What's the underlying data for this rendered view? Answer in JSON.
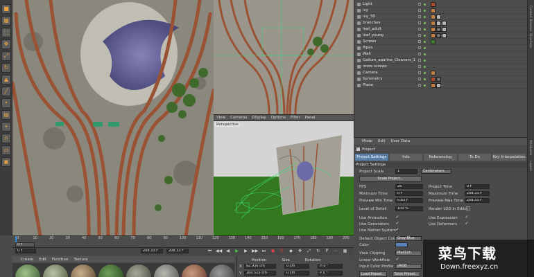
{
  "icons": {
    "toolbar": [
      "cube-icon",
      "checker-icon",
      "select-icon",
      "move-icon",
      "scale-icon",
      "rotate-icon",
      "polygon-icon",
      "edge-icon",
      "point-icon",
      "texture-icon",
      "snap-icon",
      "magnet-icon",
      "workplane-icon",
      "locked-workplane-icon"
    ],
    "transport": [
      "goto-start-icon",
      "prev-key-icon",
      "prev-frame-icon",
      "play-icon",
      "next-frame-icon",
      "next-key-icon",
      "goto-end-icon",
      "record-icon",
      "autokey-icon",
      "keyframe-icon",
      "motion-icon",
      "scale-key-icon",
      "rotate-key-icon",
      "param-key-icon",
      "pla-icon",
      "dopesheet-icon"
    ]
  },
  "viewport": {
    "menu": [
      "View",
      "Cameras",
      "Display",
      "Options",
      "Filter",
      "Panel"
    ],
    "label": "Perspective"
  },
  "objects": [
    {
      "name": "Light",
      "tags": [
        "red"
      ]
    },
    {
      "name": "ivy",
      "tags": [
        "orange"
      ]
    },
    {
      "name": "ivy_3D",
      "tags": [
        "orange",
        "chk"
      ]
    },
    {
      "name": "branches",
      "tags": [
        "orange",
        "chk",
        "chk"
      ]
    },
    {
      "name": "leaf_adult",
      "tags": [
        "orange",
        "tex",
        "chk"
      ]
    },
    {
      "name": "leaf_young",
      "tags": [
        "orange",
        "tex",
        "chk"
      ]
    },
    {
      "name": "Screws",
      "tags": [
        "grn"
      ]
    },
    {
      "name": "Pipes",
      "tags": []
    },
    {
      "name": "Wall",
      "tags": []
    },
    {
      "name": "Gallum_aparine_Cleavers_1",
      "tags": []
    },
    {
      "name": "more screws",
      "tags": []
    },
    {
      "name": "Camera",
      "tags": [
        "orange"
      ]
    },
    {
      "name": "Symmetry",
      "tags": [
        "red",
        "tex"
      ]
    },
    {
      "name": "Plane",
      "tags": [
        "orange",
        "chk"
      ]
    }
  ],
  "attributes": {
    "menu": [
      "Mode",
      "Edit",
      "User Data"
    ],
    "title": "Project",
    "tabs": [
      "Project Settings",
      "Info",
      "Referencing",
      "To Do",
      "Key Interpolation"
    ],
    "section": "Project Settings",
    "project_scale_label": "Project Scale",
    "project_scale_value": "1",
    "project_scale_unit": "Centimeters",
    "scale_project_button": "Scale Project...",
    "fps_label": "FPS",
    "fps_value": "25",
    "project_time_label": "Project Time",
    "project_time_value": "0 F",
    "min_time_label": "Minimum Time",
    "min_time_value": "0 F",
    "max_time_label": "Maximum Time",
    "max_time_value": "208.33 F",
    "prev_min_label": "Preview Min Time",
    "prev_min_value": "0.83 F",
    "prev_max_label": "Preview Max Time",
    "prev_max_value": "208.33 F",
    "lod_label": "Level of Detail",
    "lod_value": "100 %",
    "render_lod_label": "Render LOD in Editor",
    "use_animation": "Use Animation",
    "use_expression": "Use Expression",
    "use_generators": "Use Generators",
    "use_deformers": "Use Deformers",
    "use_motion": "Use Motion System",
    "default_color_label": "Default Object Color",
    "default_color_value": "Gray-Blue",
    "color_label": "Color",
    "view_clipping_label": "View Clipping",
    "view_clipping_value": "Medium",
    "linear_workflow_label": "Linear Workflow",
    "input_color_label": "Input Color Profile",
    "input_color_value": "sRGB",
    "load_preset": "Load Preset...",
    "save_preset": "Save Preset..."
  },
  "timeline": {
    "ticks": [
      "0",
      "10",
      "20",
      "30",
      "40",
      "50",
      "60",
      "70",
      "80",
      "90",
      "100",
      "110",
      "120",
      "130",
      "140",
      "150",
      "160",
      "170",
      "180",
      "190",
      "200"
    ],
    "current": "0 F",
    "field_a": "0 F",
    "field_b": "208.33 F",
    "field_c": "208.33 F"
  },
  "materials": {
    "menu": [
      "Create",
      "Edit",
      "Function",
      "Texture"
    ]
  },
  "coordinates": {
    "headers": [
      "Position",
      "Size",
      "Rotation"
    ],
    "rows": [
      {
        "pos": "92.936 cm",
        "size": "0 cm",
        "rot": "H 0 °"
      },
      {
        "pos": "160.525 cm",
        "size": "0 cm",
        "rot": "P 0 °"
      }
    ]
  },
  "right_strip": [
    "Content Browser",
    "Structure",
    "Attributes",
    "Layers"
  ],
  "watermark": {
    "title": "菜鸟下载",
    "url": "Down.freexyz.cn"
  }
}
